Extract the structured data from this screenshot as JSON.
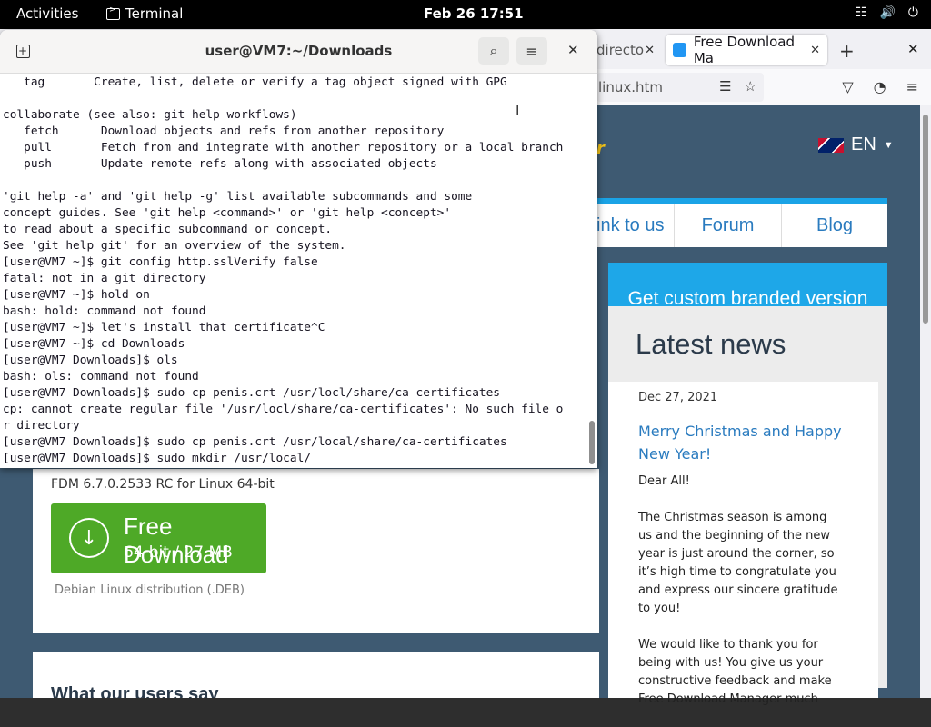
{
  "topbar": {
    "activities": "Activities",
    "app_name": "Terminal",
    "clock": "Feb 26  17:51"
  },
  "browser": {
    "tabs": [
      {
        "label": "directo"
      },
      {
        "label": "Free Download Ma"
      }
    ],
    "url": "linux.htm",
    "page": {
      "lang": "EN",
      "nav": {
        "link": "ink to us",
        "forum": "Forum",
        "blog": "Blog"
      },
      "custom_banner": "Get custom branded version",
      "news_heading": "Latest news",
      "news": {
        "date": "Dec 27, 2021",
        "title": "Merry Christmas and Happy New Year!",
        "p1": "Dear All!",
        "p2": "The Christmas season is among us and the beginning of the new year is just around the corner, so it’s high time to congratulate you and express our sincere gratitude to you!",
        "p3": "We would like to thank you for being with us! You give us your constructive feedback and make Free Download Manager much"
      },
      "product": "FDM 6.7.0.2533 RC for Linux 64-bit",
      "download_main": "Free Download",
      "download_sub": "64-bit / 27 MB",
      "distribution": "Debian Linux distribution (.DEB)",
      "users_heading": "What our users say"
    }
  },
  "terminal": {
    "title": "user@VM7:~/Downloads",
    "lines": [
      "   tag       Create, list, delete or verify a tag object signed with GPG",
      "",
      "collaborate (see also: git help workflows)",
      "   fetch      Download objects and refs from another repository",
      "   pull       Fetch from and integrate with another repository or a local branch",
      "   push       Update remote refs along with associated objects",
      "",
      "'git help -a' and 'git help -g' list available subcommands and some",
      "concept guides. See 'git help <command>' or 'git help <concept>'",
      "to read about a specific subcommand or concept.",
      "See 'git help git' for an overview of the system.",
      "[user@VM7 ~]$ git config http.sslVerify false",
      "fatal: not in a git directory",
      "[user@VM7 ~]$ hold on",
      "bash: hold: command not found",
      "[user@VM7 ~]$ let's install that certificate^C",
      "[user@VM7 ~]$ cd Downloads",
      "[user@VM7 Downloads]$ ols",
      "bash: ols: command not found",
      "[user@VM7 Downloads]$ sudo cp penis.crt /usr/locl/share/ca-certificates",
      "cp: cannot create regular file '/usr/locl/share/ca-certificates': No such file o",
      "r directory",
      "[user@VM7 Downloads]$ sudo cp penis.crt /usr/local/share/ca-certificates",
      "[user@VM7 Downloads]$ sudo mkdir /usr/local/"
    ]
  }
}
